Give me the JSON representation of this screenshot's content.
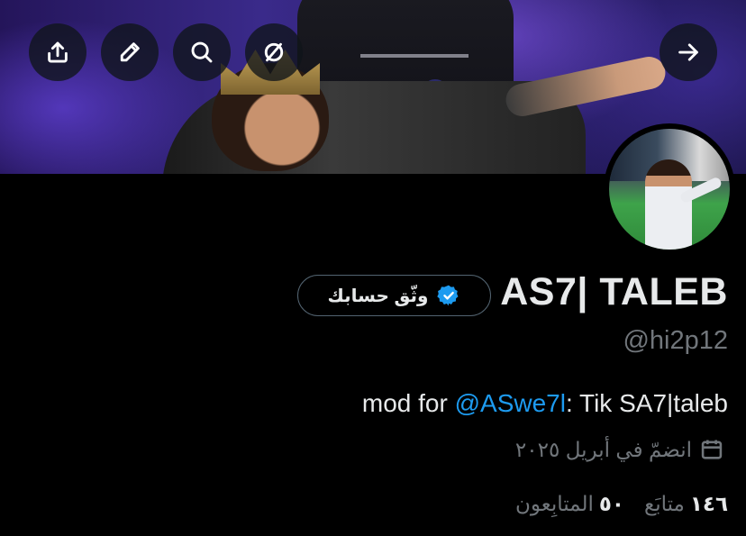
{
  "banner": {
    "icons": [
      "share-icon",
      "edit-icon",
      "search-icon",
      "hide-icon",
      "forward-icon"
    ]
  },
  "profile": {
    "display_name": "AS7| TALEB",
    "handle": "@hi2p12",
    "verify_label": "وثّق حسابك",
    "bio": {
      "prefix": "mod for ",
      "mention": "@ASwe7l",
      "suffix": ": Tik SA7|taleb"
    },
    "joined": "انضمّ في أبريل ٢٠٢٥"
  },
  "stats": {
    "following_count": "١٤٦",
    "following_label": "متابَع",
    "followers_count": "٥٠",
    "followers_label": "المتابِعون"
  },
  "colors": {
    "background": "#000000",
    "text_primary": "#e7e9ea",
    "text_secondary": "#71767b",
    "accent": "#1d9bf0"
  }
}
